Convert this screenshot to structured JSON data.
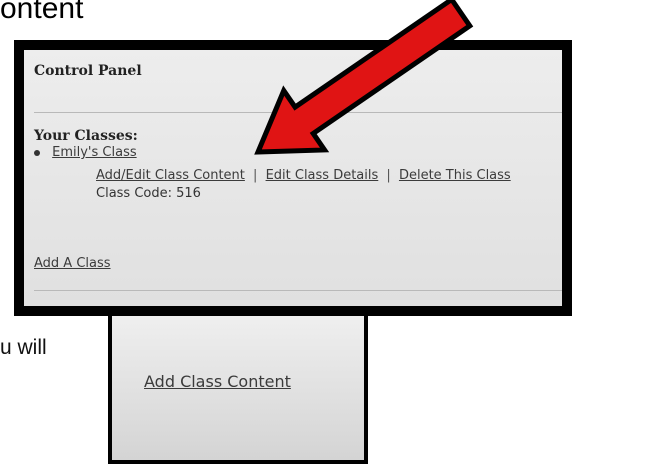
{
  "heading": "ontent",
  "body_fragment": "u will",
  "panel": {
    "title": "Control Panel",
    "classes_heading": "Your Classes:",
    "class_name": "Emily's Class",
    "actions": [
      "Add/Edit Class Content",
      "Edit Class Details",
      "Delete This Class"
    ],
    "separator": "|",
    "class_code": "Class Code: 516",
    "add_class": "Add A Class"
  },
  "small_shot": {
    "link": "Add Class Content"
  },
  "colors": {
    "arrow": "#e01414",
    "border": "#000000",
    "panel_bg": "#e6e6e6"
  }
}
